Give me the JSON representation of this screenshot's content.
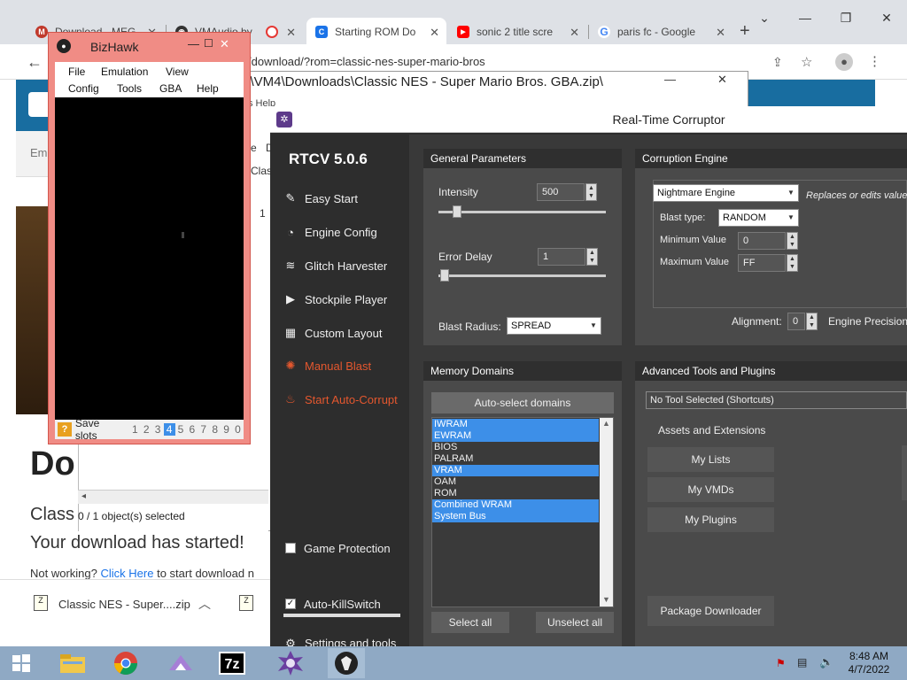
{
  "chrome": {
    "tabs": [
      {
        "label": "Download - MEG",
        "fav_color": "#c0392b",
        "fav_glyph": "M"
      },
      {
        "label": "VMAudio by",
        "fav_color": "#333333",
        "fav_glyph": "◉"
      },
      {
        "label": "",
        "fav_color": "#e53935",
        "fav_glyph": "●"
      },
      {
        "label": "Starting ROM Do",
        "fav_color": "#1a73e8",
        "fav_glyph": "C"
      },
      {
        "label": "sonic 2 title scre",
        "fav_color": "#ff0000",
        "fav_glyph": "▶"
      },
      {
        "label": "paris fc - Google",
        "fav_color": "#4285f4",
        "fav_glyph": "G"
      }
    ],
    "new_tab": "+",
    "url": "/download/?rom=classic-nes-super-mario-bros"
  },
  "webpage": {
    "em_label": "Em",
    "heading": "Do",
    "sub": "Class",
    "started": "Your download has started!",
    "not_working": "Not working?",
    "click_here": "Click Here",
    "after_link": "to start download n",
    "download_item": "Classic NES - Super....zip"
  },
  "explorer": {
    "title": "rs\\VM4\\Downloads\\Classic NES - Super Mario Bros. GBA.zip\\",
    "menu_tail": "s     Help",
    "status": "0 / 1 object(s) selected",
    "side_letters": [
      "e",
      "D",
      "Clas"
    ],
    "count": "1"
  },
  "bizhawk": {
    "title": "BizHawk",
    "menu": [
      "File",
      "Emulation",
      "View",
      "Config",
      "Tools",
      "GBA",
      "Help"
    ],
    "save_slots_label": "Save slots",
    "slots": [
      "1",
      "2",
      "3",
      "4",
      "5",
      "6",
      "7",
      "8",
      "9",
      "0"
    ],
    "selected_slot": "4"
  },
  "rtcv": {
    "window_title": "Real-Time Corruptor",
    "version": "RTCV 5.0.6",
    "nav": [
      {
        "label": "Easy Start",
        "icon": "✎",
        "red": false
      },
      {
        "label": "Engine Config",
        "icon": "◔",
        "red": false
      },
      {
        "label": "Glitch Harvester",
        "icon": "≋",
        "red": false
      },
      {
        "label": "Stockpile Player",
        "icon": "▶",
        "red": false
      },
      {
        "label": "Custom Layout",
        "icon": "▦",
        "red": false
      },
      {
        "label": "Manual Blast",
        "icon": "✺",
        "red": true
      },
      {
        "label": "Start Auto-Corrupt",
        "icon": "♨",
        "red": true
      }
    ],
    "game_protection": "Game Protection",
    "auto_killswitch": "Auto-KillSwitch",
    "settings": "Settings and tools",
    "general": {
      "header": "General Parameters",
      "intensity_label": "Intensity",
      "intensity_value": "500",
      "error_delay_label": "Error Delay",
      "error_delay_value": "1",
      "blast_radius_label": "Blast Radius:",
      "blast_radius_value": "SPREAD"
    },
    "engine": {
      "header": "Corruption Engine",
      "engine_value": "Nightmare Engine",
      "engine_desc": "Replaces or edits values",
      "blast_type_label": "Blast type:",
      "blast_type_value": "RANDOM",
      "min_label": "Minimum Value",
      "min_value": "0",
      "max_label": "Maximum Value",
      "max_value": "FF",
      "alignment_label": "Alignment:",
      "alignment_value": "0",
      "precision_label": "Engine Precision:"
    },
    "memory": {
      "header": "Memory Domains",
      "auto_select": "Auto-select domains",
      "domains": [
        {
          "name": "IWRAM",
          "selected": true
        },
        {
          "name": "EWRAM",
          "selected": true
        },
        {
          "name": "BIOS",
          "selected": false
        },
        {
          "name": "PALRAM",
          "selected": false
        },
        {
          "name": "VRAM",
          "selected": true
        },
        {
          "name": "OAM",
          "selected": false
        },
        {
          "name": "ROM",
          "selected": false
        },
        {
          "name": "Combined WRAM",
          "selected": true
        },
        {
          "name": "System Bus",
          "selected": true
        }
      ],
      "select_all": "Select all",
      "unselect_all": "Unselect all"
    },
    "advanced": {
      "header": "Advanced Tools and Plugins",
      "tool_select": "No Tool Selected (Shortcuts)",
      "assets_label": "Assets and Extensions",
      "my_lists": "My Lists",
      "my_vmds": "My VMDs",
      "my_plugins": "My Plugins",
      "package_downloader": "Package Downloader"
    }
  },
  "taskbar": {
    "time": "8:48 AM",
    "date": "4/7/2022"
  }
}
